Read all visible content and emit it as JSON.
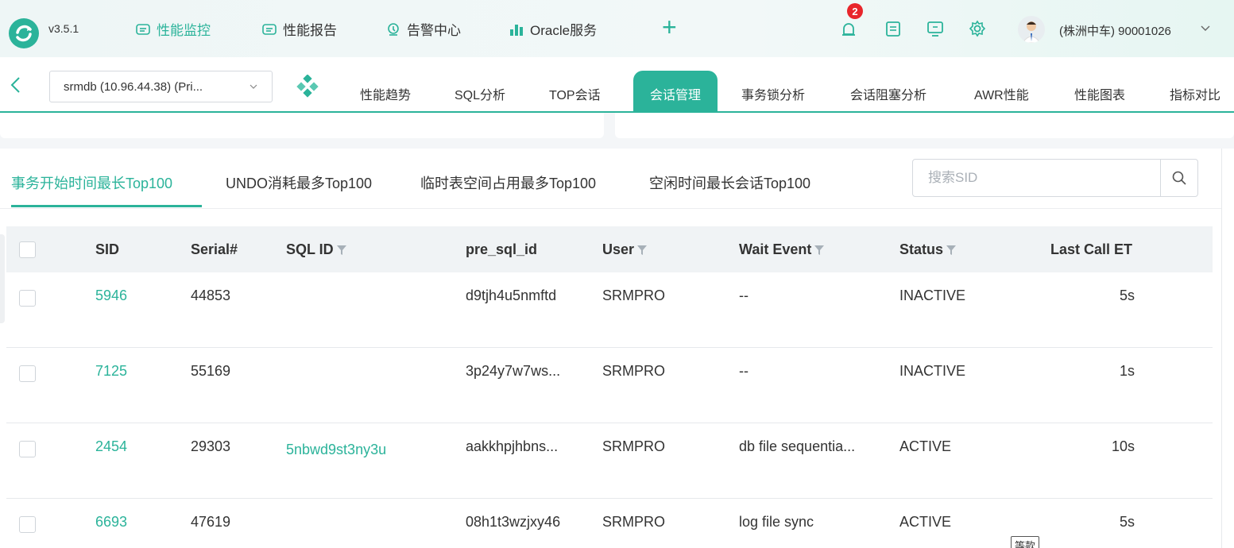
{
  "header": {
    "version": "v3.5.1",
    "nav": [
      {
        "label": "性能监控",
        "icon": "monitor-icon",
        "active": true
      },
      {
        "label": "性能报告",
        "icon": "report-icon",
        "active": false
      },
      {
        "label": "告警中心",
        "icon": "alarm-icon",
        "active": false
      },
      {
        "label": "Oracle服务",
        "icon": "bar-chart-icon",
        "active": false
      }
    ],
    "notification_count": "2",
    "user": "(株洲中车) 90001026"
  },
  "subbar": {
    "db_select": "srmdb (10.96.44.38) (Pri...",
    "tabs": [
      "性能趋势",
      "SQL分析",
      "TOP会话",
      "会话管理",
      "事务锁分析",
      "会话阻塞分析",
      "AWR性能",
      "性能图表",
      "指标对比"
    ],
    "active_tab": "会话管理"
  },
  "content_tabs": [
    "事务开始时间最长Top100",
    "UNDO消耗最多Top100",
    "临时表空间占用最多Top100",
    "空闲时间最长会话Top100"
  ],
  "search": {
    "placeholder": "搜索SID",
    "value": ""
  },
  "table": {
    "columns": [
      "SID",
      "Serial#",
      "SQL ID",
      "pre_sql_id",
      "User",
      "Wait Event",
      "Status",
      "Last Call ET"
    ],
    "rows": [
      {
        "sid": "5946",
        "serial": "44853",
        "sql_id": "",
        "pre_sql_id": "d9tjh4u5nmftd",
        "user": "SRMPRO",
        "wait_event": "--",
        "status": "INACTIVE",
        "last_call_et": "5s"
      },
      {
        "sid": "7125",
        "serial": "55169",
        "sql_id": "",
        "pre_sql_id": "3p24y7w7ws...",
        "user": "SRMPRO",
        "wait_event": "--",
        "status": "INACTIVE",
        "last_call_et": "1s"
      },
      {
        "sid": "2454",
        "serial": "29303",
        "sql_id": "5nbwd9st3ny3u",
        "pre_sql_id": "aakkhpjhbns...",
        "user": "SRMPRO",
        "wait_event": "db file sequentia...",
        "status": "ACTIVE",
        "last_call_et": "10s"
      },
      {
        "sid": "6693",
        "serial": "47619",
        "sql_id": "",
        "pre_sql_id": "08h1t3wzjxy46",
        "user": "SRMPRO",
        "wait_event": "log file sync",
        "status": "ACTIVE",
        "last_call_et": "5s"
      }
    ]
  },
  "tooltip": "等款",
  "colors": {
    "accent": "#2bb39a",
    "badge": "#e8262b"
  }
}
